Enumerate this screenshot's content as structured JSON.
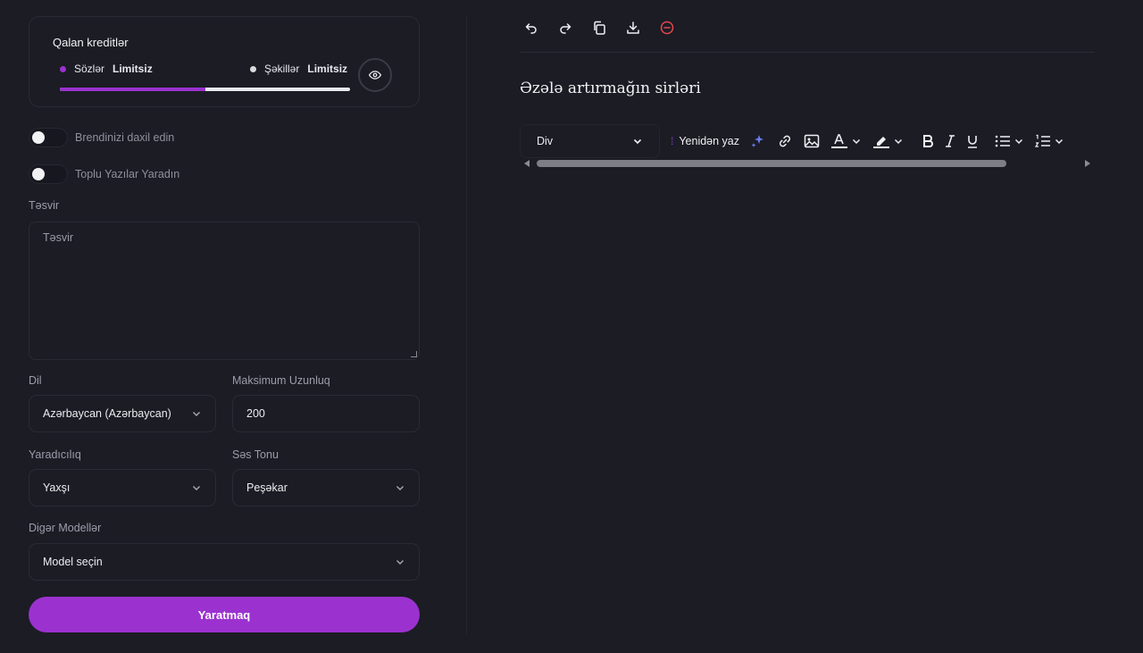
{
  "credits": {
    "title": "Qalan kreditlər",
    "words_label": "Sözlər",
    "words_value": "Limitsiz",
    "images_label": "Şəkillər",
    "images_value": "Limitsiz",
    "usage_fraction": 0.5
  },
  "toggles": {
    "brand_label": "Brendinizi daxil edin",
    "bulk_label": "Toplu Yazılar Yaradın"
  },
  "description": {
    "label": "Təsvir",
    "placeholder": "Təsvir"
  },
  "language": {
    "label": "Dil",
    "value": "Azərbaycan (Azərbaycan)"
  },
  "max_length": {
    "label": "Maksimum Uzunluq",
    "value": "200"
  },
  "creativity": {
    "label": "Yaradıcılıq",
    "value": "Yaxşı"
  },
  "tone": {
    "label": "Səs Tonu",
    "value": "Peşəkar"
  },
  "other_models": {
    "label": "Digər Modellər",
    "value": "Model seçin"
  },
  "generate_label": "Yaratmaq",
  "editor": {
    "toolbar_icons": [
      "undo-icon",
      "redo-icon",
      "copy-icon",
      "download-icon",
      "delete-icon"
    ],
    "title": "Əzələ artırmağın sirləri",
    "block_type": "Div",
    "rewrite_label": "Yenidən yaz"
  },
  "colors": {
    "accent": "#9b32cf",
    "background": "#1b1c24",
    "delete": "#e5484d"
  }
}
